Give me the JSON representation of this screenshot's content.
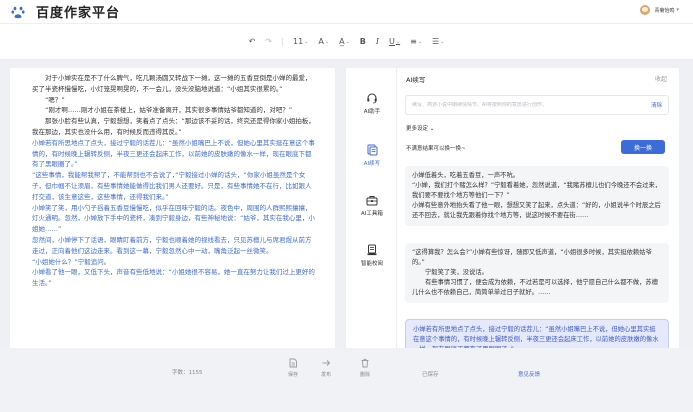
{
  "header": {
    "title": "百度作家平台",
    "user_name": "青菊怡鸣"
  },
  "toolbar": {
    "font_size": "11"
  },
  "editor": {
    "paragraphs": [
      {
        "text": "对于小婵实在是不了什么脾气，吃几颗汤圆又转战下一摊，这一摊的五香豆倒是小婵的最爱，买了半瓷杯慢慢吃，小灯笼晃啊晃的，不一会儿，没头没脑地说道：“小姐其实很累的。”",
        "highlight": false,
        "indent": true
      },
      {
        "text": "“嗯？”",
        "highlight": false,
        "indent": true
      },
      {
        "text": "“刚才啊……刚才小姐在茶楼上，姑爷准备离开，其实很多事情姑爷都知道的，对吧？”",
        "highlight": false,
        "indent": true
      },
      {
        "text": "那张小脸有些认真，宁毅想想，笑着点了点头：“那边该不妥的话，终究还是得你家小姐拍板，我在那边，其实也没什么用，有时候反而违得其反。”",
        "highlight": false,
        "indent": true
      },
      {
        "text": "小婵若有所思地点了点头，接过宁毅的话茬儿：“虽然小姐嘴巴上不说，但她心里其实挺在意这个事情的，有时候晚上辗转反侧，半夜三更还会起床工作，以前她的皮肤嫩的像水一样，现在眼底下都有了黑眼圈了。”",
        "highlight": true,
        "indent": false
      },
      {
        "text": "“这些事情，我能帮我帮了，不能帮到也不会说了，”宁毅接过小婵的话头，“你家小姐虽然是个女子，但巾帼不让须眉，有些事情她能做得比我们男人还要好。只是，有些事情她不在行，比如跟人打交道，该生意这些，这些事情，还得我们来。”",
        "highlight": true,
        "indent": false
      },
      {
        "text": "小婵笑了笑，用小勺子舀着五香豆慢慢吃，似乎在回味宁毅的话。夜色中，周围的人群熙熙攘攘，灯火通明。忽然，小婵放下手中的瓷杯，凑到宁毅身边，有些神秘地说：“姑爷，其实在我心里，小姐她……”",
        "highlight": true,
        "indent": false
      },
      {
        "text": "忽然间，小婵停下了话语，眼睛盯着前方，宁毅也顺着她的视线看去，只见苏檀儿与席君煜从前方走过，正向着他们这边走来。看到这一幕，宁毅忽然心中一动，嘴角泛起一丝微笑。",
        "highlight": true,
        "indent": false
      },
      {
        "text": "“小姐她什么？”宁毅追问。",
        "highlight": true,
        "indent": false
      },
      {
        "text": "小婵看了他一眼，又低下头，声音有些低地说：“小姐她很不容易，她一直在努力让我们过上更好的生活。”",
        "highlight": true,
        "indent": false
      }
    ]
  },
  "sidebar": {
    "items": [
      {
        "label": "AI助手",
        "icon": "headset-icon"
      },
      {
        "label": "AI续写",
        "icon": "document-icon"
      },
      {
        "label": "AI工具箱",
        "icon": "toolbox-icon"
      },
      {
        "label": "智能校阅",
        "icon": "proofread-icon"
      }
    ]
  },
  "panel": {
    "title": "AI续写",
    "close_label": "收起",
    "prompt_placeholder": "续写、简述小说中期续情情节、AI将按照你的意愿进行创作。",
    "clear_label": "清除",
    "more_settings": "更多设定 ⌄",
    "tip": "不满意结果可以换一换~",
    "swap_label": "换一换",
    "cards": [
      {
        "paragraphs": [
          {
            "text": "小婵低着头，吃着五香豆，一声不吭。",
            "indent": false
          },
          {
            "text": "“小婵，我们打个赌怎么样？”宁毅看着她，忽然说道，“我赌苏檀儿也们今晚还不会过来，我们要不要找个地方等他们一下？”",
            "indent": false
          },
          {
            "text": "小婵有些意外地抬头看了他一眼，想想又笑了起来，点头道：“好的，小姐说半个时辰之后还不回去，就让我先跟着你找个地方等，说这时候不要在街……",
            "indent": false
          }
        ]
      },
      {
        "paragraphs": [
          {
            "text": "“这得算我？怎么会?”小婵有些惊讶，随即又低声道，“小姐很多时候，其实挺依赖姑爷的。”",
            "indent": false
          },
          {
            "text": "宁毅笑了笑，没说话。",
            "indent": true
          },
          {
            "text": "有些事情习惯了，便会成为依赖，不过若是可以选择，他宁愿自己什么都不做，苏檀儿什么也不依赖自己，简简单单过日子就好。……",
            "indent": true
          }
        ]
      },
      {
        "paragraphs": [
          {
            "text": "小婵若有所思地点了点头，接过宁毅的话茬儿：“虽然小姐嘴巴上不说，但她心里其实挺在意这个事情的，有时候晚上辗转反侧，半夜三更还会起床工作，以前她的皮肤嫩的像水一样，现在眼底下都有了黑眼圈了。”",
            "indent": false
          }
        ]
      }
    ]
  },
  "footer": {
    "word_count": "字数：1155",
    "save_label": "保存",
    "publish_label": "发布",
    "delete_label": "删除",
    "saved_status": "已保存",
    "feedback_label": "意见反馈"
  }
}
